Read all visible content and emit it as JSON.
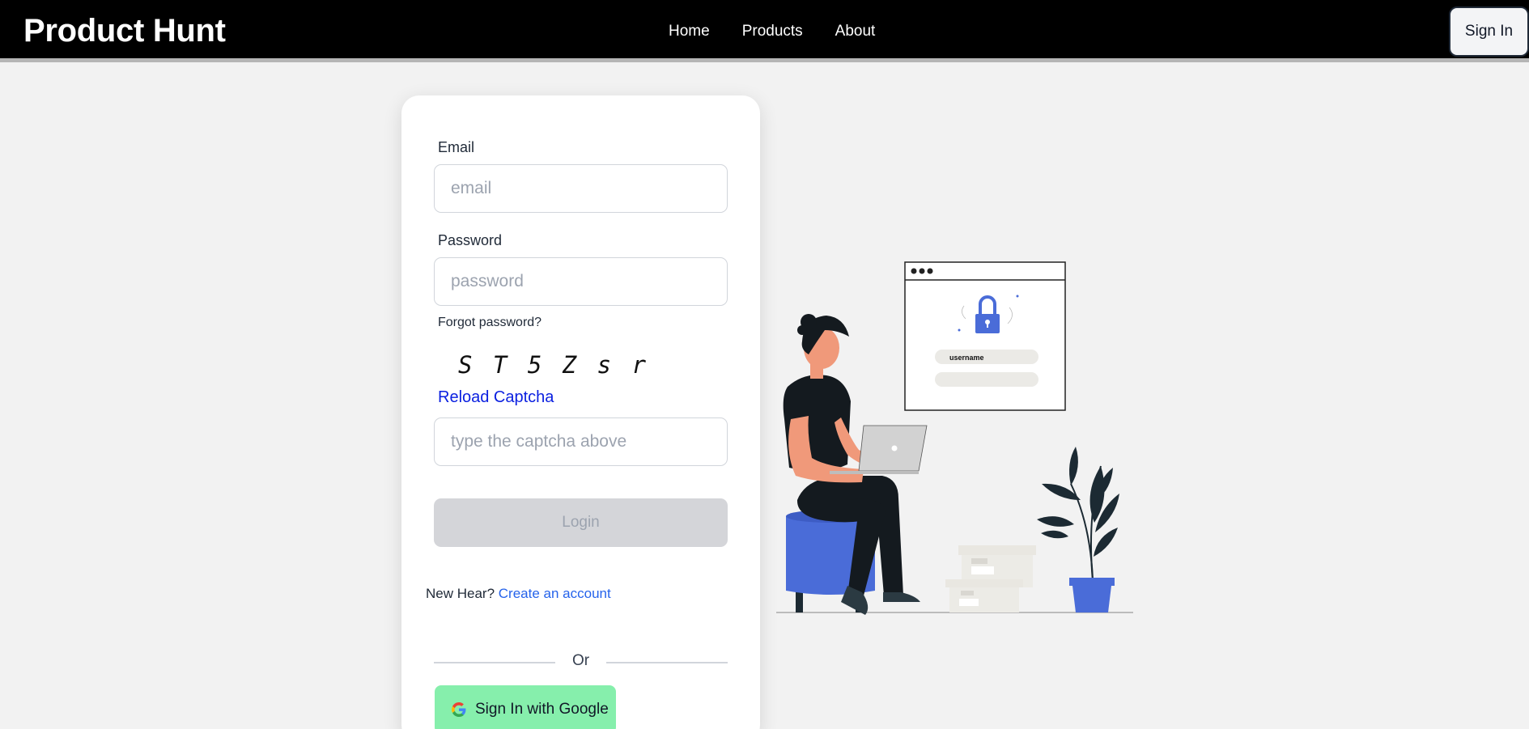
{
  "navbar": {
    "brand": "Product Hunt",
    "links": [
      "Home",
      "Products",
      "About"
    ],
    "signin_label": "Sign In"
  },
  "login_form": {
    "email_label": "Email",
    "email_placeholder": "email",
    "email_value": "",
    "password_label": "Password",
    "password_placeholder": "password",
    "password_value": "",
    "forgot_label": "Forgot password?",
    "captcha_text": "ST5Zsr",
    "reload_label": "Reload Captcha",
    "captcha_placeholder": "type the captcha above",
    "captcha_value": "",
    "login_label": "Login",
    "new_here_text": "New Hear?",
    "create_account_label": "Create an account",
    "or_text": "Or",
    "google_label": "Sign In with Google"
  },
  "illustration": {
    "username_text": "username",
    "icon": "lock-icon"
  },
  "colors": {
    "navbar_bg": "#000000",
    "page_bg": "#f2f2f2",
    "card_bg": "#ffffff",
    "login_disabled": "#d4d5d9",
    "google_btn": "#86efac",
    "link_blue": "#2563eb",
    "accent_blue": "#4a6cd8"
  }
}
